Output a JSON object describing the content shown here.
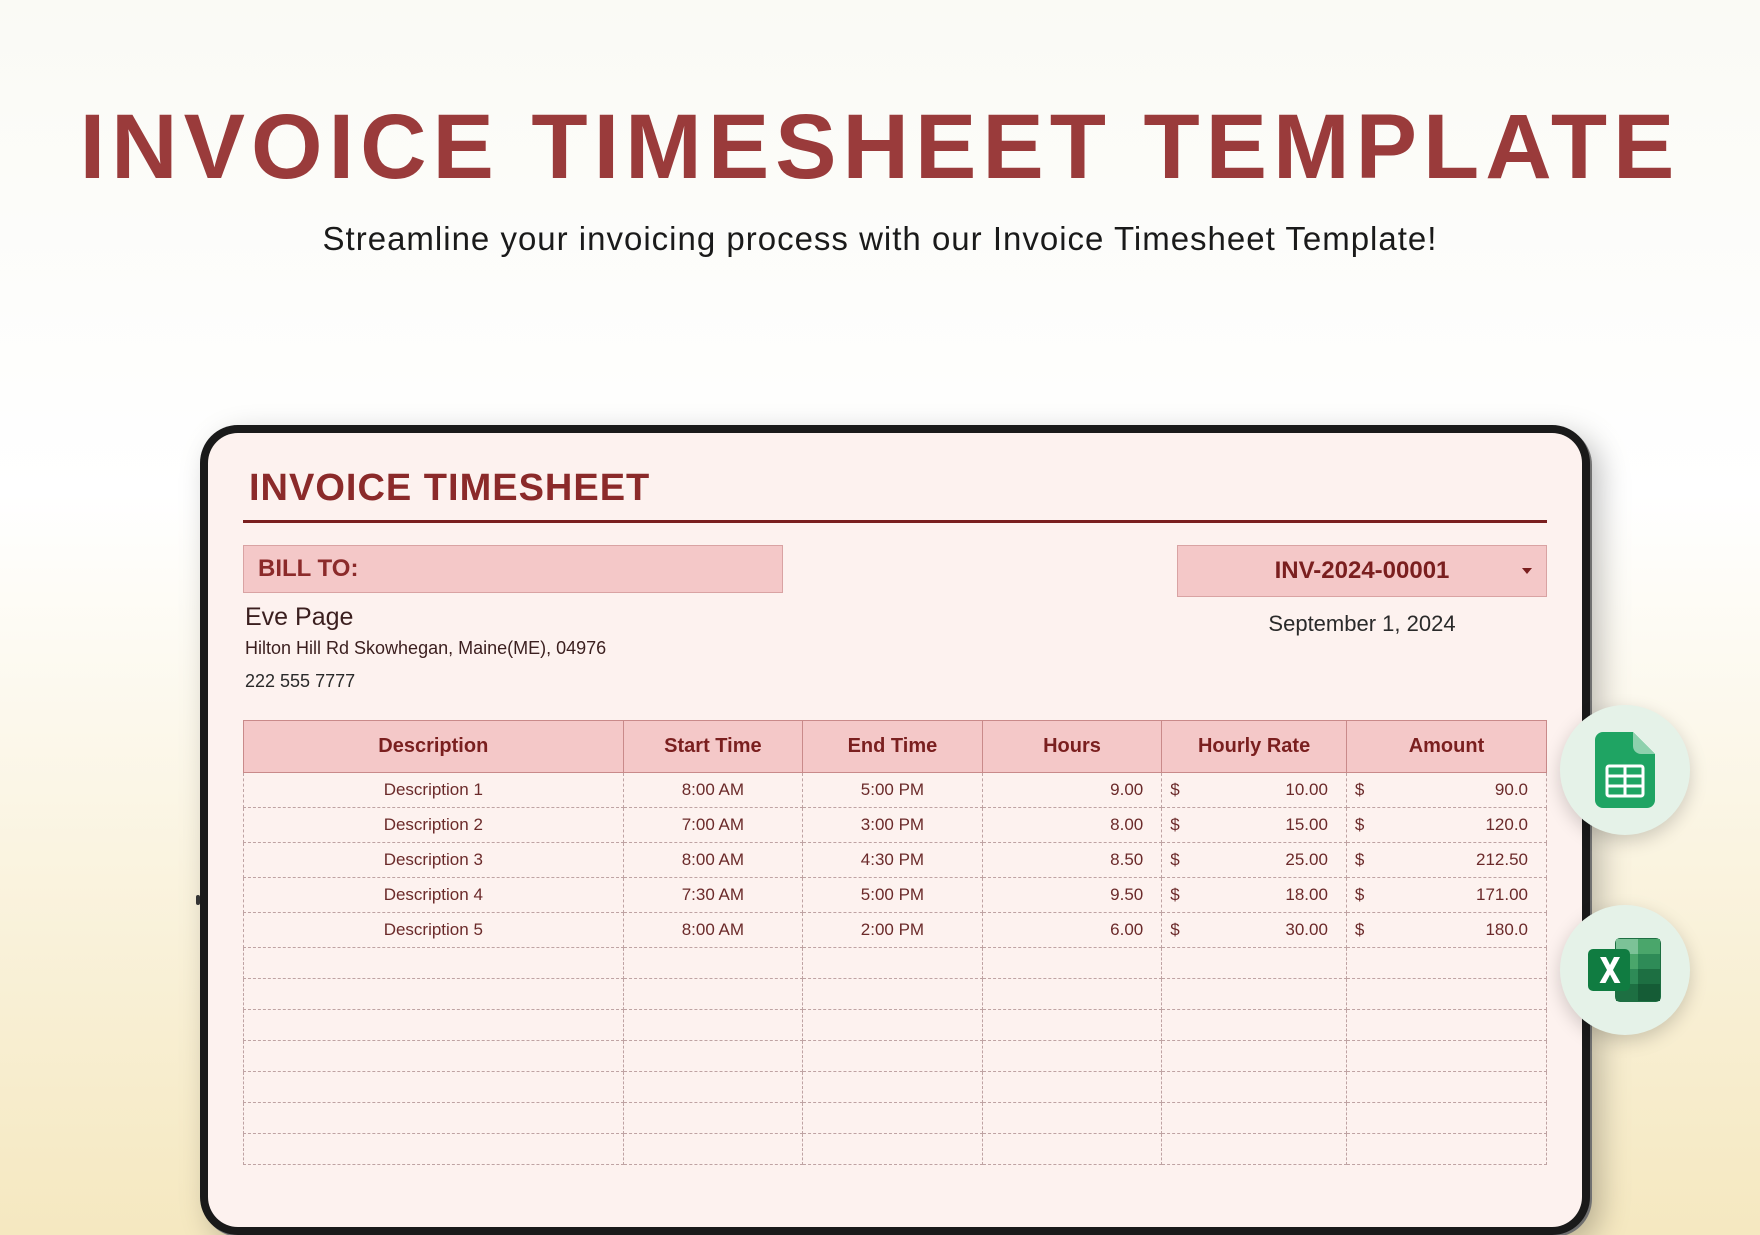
{
  "page": {
    "title": "INVOICE TIMESHEET TEMPLATE",
    "subtitle": "Streamline your invoicing process with our Invoice Timesheet Template!"
  },
  "doc": {
    "title": "INVOICE TIMESHEET",
    "bill_to_label": "BILL TO:",
    "bill_name": "Eve Page",
    "bill_address": "Hilton Hill Rd Skowhegan, Maine(ME), 04976",
    "bill_phone": "222 555 7777",
    "invoice_number": "INV-2024-00001",
    "invoice_date": "September 1, 2024"
  },
  "columns": {
    "desc": "Description",
    "start": "Start Time",
    "end": "End Time",
    "hours": "Hours",
    "rate": "Hourly Rate",
    "amount": "Amount"
  },
  "currency": "$",
  "chart_data": {
    "type": "table",
    "columns": [
      "Description",
      "Start Time",
      "End Time",
      "Hours",
      "Hourly Rate",
      "Amount"
    ],
    "rows": [
      {
        "desc": "Description 1",
        "start": "8:00 AM",
        "end": "5:00 PM",
        "hours": "9.00",
        "rate": "10.00",
        "amount": "90.0"
      },
      {
        "desc": "Description 2",
        "start": "7:00 AM",
        "end": "3:00 PM",
        "hours": "8.00",
        "rate": "15.00",
        "amount": "120.0"
      },
      {
        "desc": "Description 3",
        "start": "8:00 AM",
        "end": "4:30 PM",
        "hours": "8.50",
        "rate": "25.00",
        "amount": "212.50"
      },
      {
        "desc": "Description 4",
        "start": "7:30 AM",
        "end": "5:00 PM",
        "hours": "9.50",
        "rate": "18.00",
        "amount": "171.00"
      },
      {
        "desc": "Description 5",
        "start": "8:00 AM",
        "end": "2:00 PM",
        "hours": "6.00",
        "rate": "30.00",
        "amount": "180.0"
      }
    ],
    "empty_rows": 7
  },
  "badges": {
    "sheets": "google-sheets-icon",
    "excel": "excel-icon"
  }
}
